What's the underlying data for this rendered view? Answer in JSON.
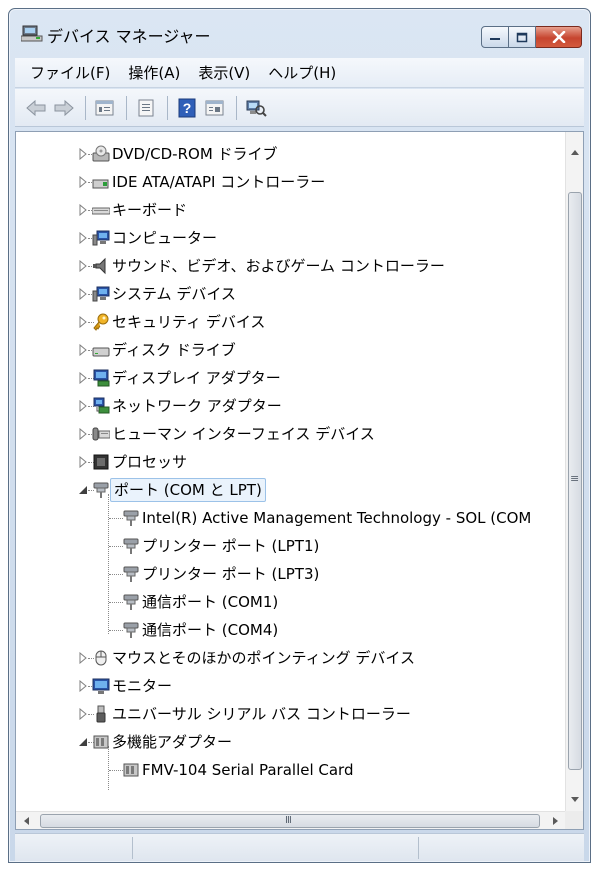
{
  "window": {
    "title": "デバイス マネージャー",
    "title_icon": "device-manager-icon"
  },
  "menu": [
    {
      "label": "ファイル(F)"
    },
    {
      "label": "操作(A)"
    },
    {
      "label": "表示(V)"
    },
    {
      "label": "ヘルプ(H)"
    }
  ],
  "toolbar": [
    "back-arrow-icon",
    "forward-arrow-icon",
    "show-hidden-icon",
    "properties-icon",
    "help-icon",
    "view-icon",
    "scan-hardware-icon"
  ],
  "tree": [
    {
      "label": "DVD/CD-ROM ドライブ",
      "icon": "dvd-drive-icon",
      "expanded": false
    },
    {
      "label": "IDE ATA/ATAPI コントローラー",
      "icon": "ide-controller-icon",
      "expanded": false
    },
    {
      "label": "キーボード",
      "icon": "keyboard-icon",
      "expanded": false
    },
    {
      "label": "コンピューター",
      "icon": "computer-icon",
      "expanded": false
    },
    {
      "label": "サウンド、ビデオ、およびゲーム コントローラー",
      "icon": "speaker-icon",
      "expanded": false
    },
    {
      "label": "システム デバイス",
      "icon": "system-device-icon",
      "expanded": false
    },
    {
      "label": "セキュリティ デバイス",
      "icon": "security-key-icon",
      "expanded": false
    },
    {
      "label": "ディスク ドライブ",
      "icon": "disk-drive-icon",
      "expanded": false
    },
    {
      "label": "ディスプレイ アダプター",
      "icon": "display-adapter-icon",
      "expanded": false
    },
    {
      "label": "ネットワーク アダプター",
      "icon": "network-adapter-icon",
      "expanded": false
    },
    {
      "label": "ヒューマン インターフェイス デバイス",
      "icon": "hid-icon",
      "expanded": false
    },
    {
      "label": "プロセッサ",
      "icon": "processor-icon",
      "expanded": false
    },
    {
      "label": "ポート (COM と LPT)",
      "icon": "port-icon",
      "expanded": true,
      "selected": true,
      "children": [
        {
          "label": "Intel(R) Active Management Technology - SOL (COM",
          "icon": "port-icon"
        },
        {
          "label": "プリンター ポート (LPT1)",
          "icon": "port-icon"
        },
        {
          "label": "プリンター ポート (LPT3)",
          "icon": "port-icon"
        },
        {
          "label": "通信ポート (COM1)",
          "icon": "port-icon"
        },
        {
          "label": "通信ポート (COM4)",
          "icon": "port-icon"
        }
      ]
    },
    {
      "label": "マウスとそのほかのポインティング デバイス",
      "icon": "mouse-icon",
      "expanded": false
    },
    {
      "label": "モニター",
      "icon": "monitor-icon",
      "expanded": false
    },
    {
      "label": "ユニバーサル シリアル バス コントローラー",
      "icon": "usb-icon",
      "expanded": false
    },
    {
      "label": "多機能アダプター",
      "icon": "multifunction-adapter-icon",
      "expanded": true,
      "children": [
        {
          "label": "FMV-104 Serial Parallel Card",
          "icon": "multifunction-adapter-icon"
        }
      ]
    }
  ],
  "scrollbar": {
    "vertical_grip": "≡",
    "horizontal_grip": "Ⅲ"
  }
}
